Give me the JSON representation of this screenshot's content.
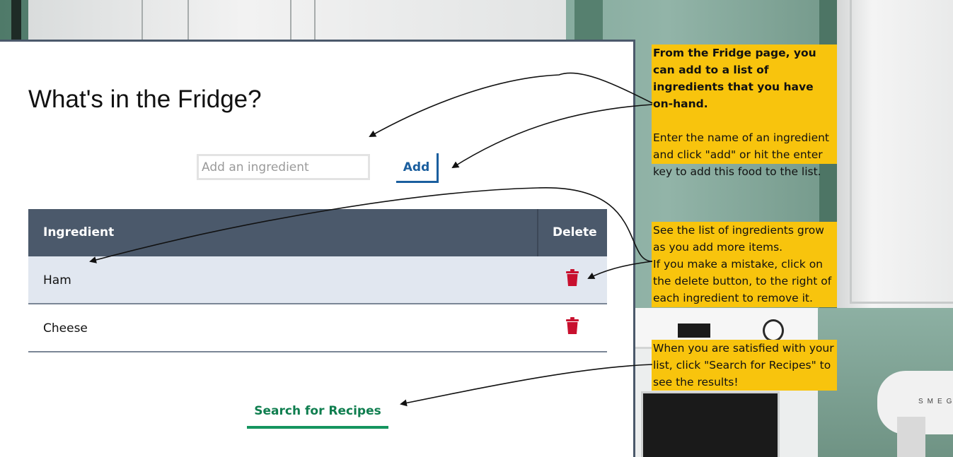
{
  "app": {
    "title": "What's in the Fridge?",
    "input": {
      "placeholder": "Add an ingredient",
      "value": ""
    },
    "add_label": "Add",
    "table": {
      "headers": {
        "ingredient": "Ingredient",
        "delete": "Delete"
      },
      "rows": [
        {
          "label": "Ham"
        },
        {
          "label": "Cheese"
        }
      ]
    },
    "search_label": "Search for Recipes"
  },
  "callouts": {
    "intro_bold": "From the Fridge page, you can add to a list of ingredients that you have on-hand.",
    "intro_body": "Enter the name of an ingredient and click \"add\" or hit the enter key to add this food to the list.",
    "list_grow": "See the list of ingredients grow as you add more items.",
    "list_delete": "If you make a mistake, click on the delete button, to the right of each ingredient to remove it.",
    "search": "When you are satisfied with your list, click \"Search for Recipes\" to see the results!"
  },
  "colors": {
    "header_bg": "#4b596b",
    "row_alt_bg": "#e1e7f0",
    "add_accent": "#1a5e9e",
    "search_accent": "#15955f",
    "trash": "#c8102e",
    "callout_bg": "#f8c40d"
  },
  "icons": {
    "delete": "trash-icon",
    "arrow": "arrow-icon"
  }
}
